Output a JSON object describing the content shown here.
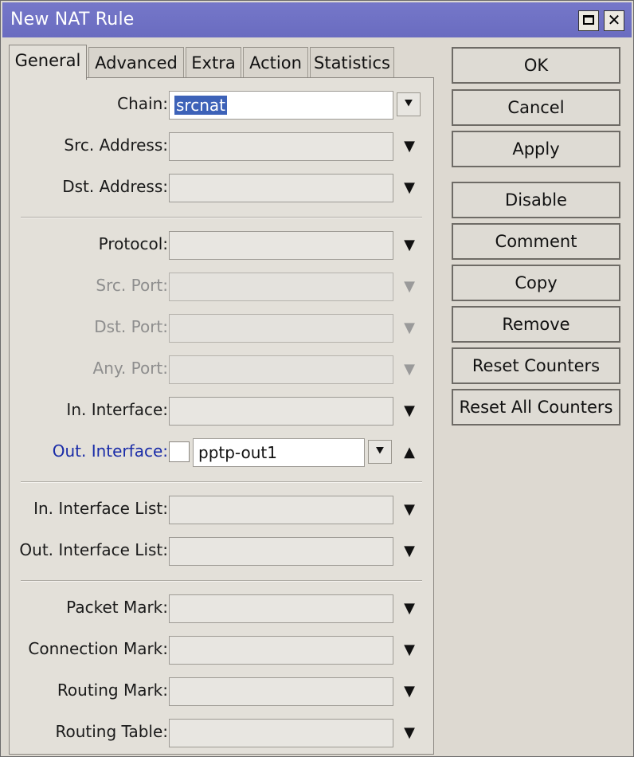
{
  "window": {
    "title": "New NAT Rule",
    "maximize_icon": "maximize-icon",
    "close_label": "✕"
  },
  "tabs": [
    {
      "label": "General",
      "active": true
    },
    {
      "label": "Advanced"
    },
    {
      "label": "Extra"
    },
    {
      "label": "Action"
    },
    {
      "label": "Statistics"
    }
  ],
  "form": {
    "chain": {
      "label": "Chain:",
      "value": "srcnat"
    },
    "src_address": {
      "label": "Src. Address:",
      "value": ""
    },
    "dst_address": {
      "label": "Dst. Address:",
      "value": ""
    },
    "protocol": {
      "label": "Protocol:",
      "value": ""
    },
    "src_port": {
      "label": "Src. Port:",
      "value": ""
    },
    "dst_port": {
      "label": "Dst. Port:",
      "value": ""
    },
    "any_port": {
      "label": "Any. Port:",
      "value": ""
    },
    "in_interface": {
      "label": "In. Interface:",
      "value": ""
    },
    "out_interface": {
      "label": "Out. Interface:",
      "value": "pptp-out1",
      "negate_checked": false
    },
    "in_interface_list": {
      "label": "In. Interface List:",
      "value": ""
    },
    "out_interface_list": {
      "label": "Out. Interface List:",
      "value": ""
    },
    "packet_mark": {
      "label": "Packet Mark:",
      "value": ""
    },
    "connection_mark": {
      "label": "Connection Mark:",
      "value": ""
    },
    "routing_mark": {
      "label": "Routing Mark:",
      "value": ""
    },
    "routing_table": {
      "label": "Routing Table:",
      "value": ""
    }
  },
  "glyphs": {
    "down": "▼",
    "up": "▲",
    "down_box": "⯆"
  },
  "buttons": {
    "ok": "OK",
    "cancel": "Cancel",
    "apply": "Apply",
    "disable": "Disable",
    "comment": "Comment",
    "copy": "Copy",
    "remove": "Remove",
    "reset_counters": "Reset Counters",
    "reset_all_counters": "Reset All Counters"
  },
  "colors": {
    "titlebar": "#6a6cc0",
    "selection": "#3d62b8",
    "out_interface_label": "#1a2ca8"
  }
}
